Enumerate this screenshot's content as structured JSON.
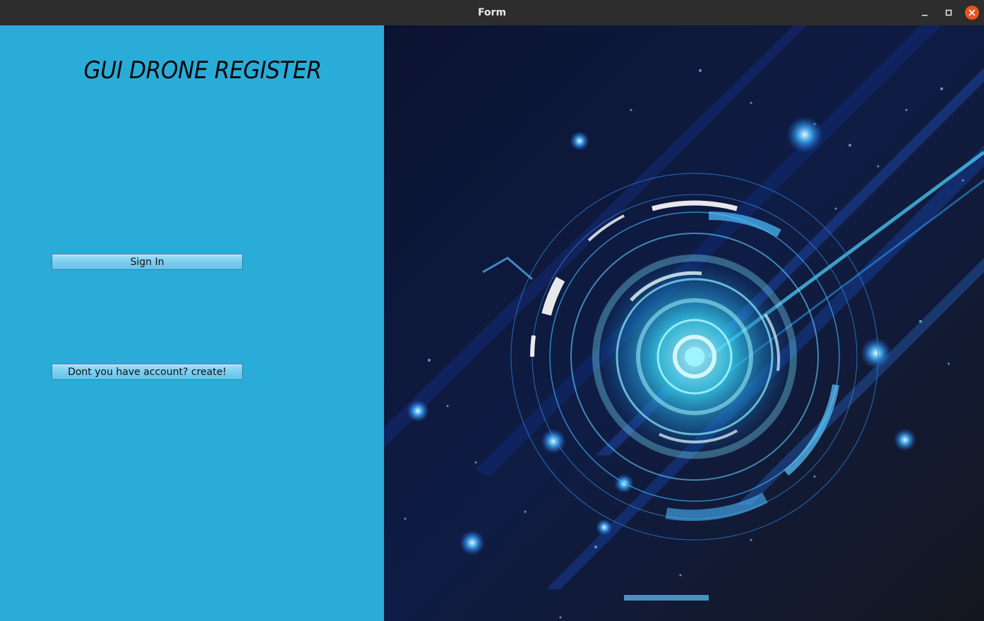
{
  "window": {
    "title": "Form"
  },
  "form": {
    "heading": "GUI DRONE REGISTER",
    "sign_in_label": "Sign In",
    "create_account_label": "Dont you have account? create!"
  },
  "colors": {
    "panel_background": "#2aacd9",
    "title_bar": "#2d2d2d",
    "close_button": "#e95420",
    "image_dark": "#0d1630",
    "image_glow": "#3fd4ff"
  },
  "icons": {
    "minimize": "minimize-icon",
    "maximize": "maximize-icon",
    "close": "close-icon"
  }
}
